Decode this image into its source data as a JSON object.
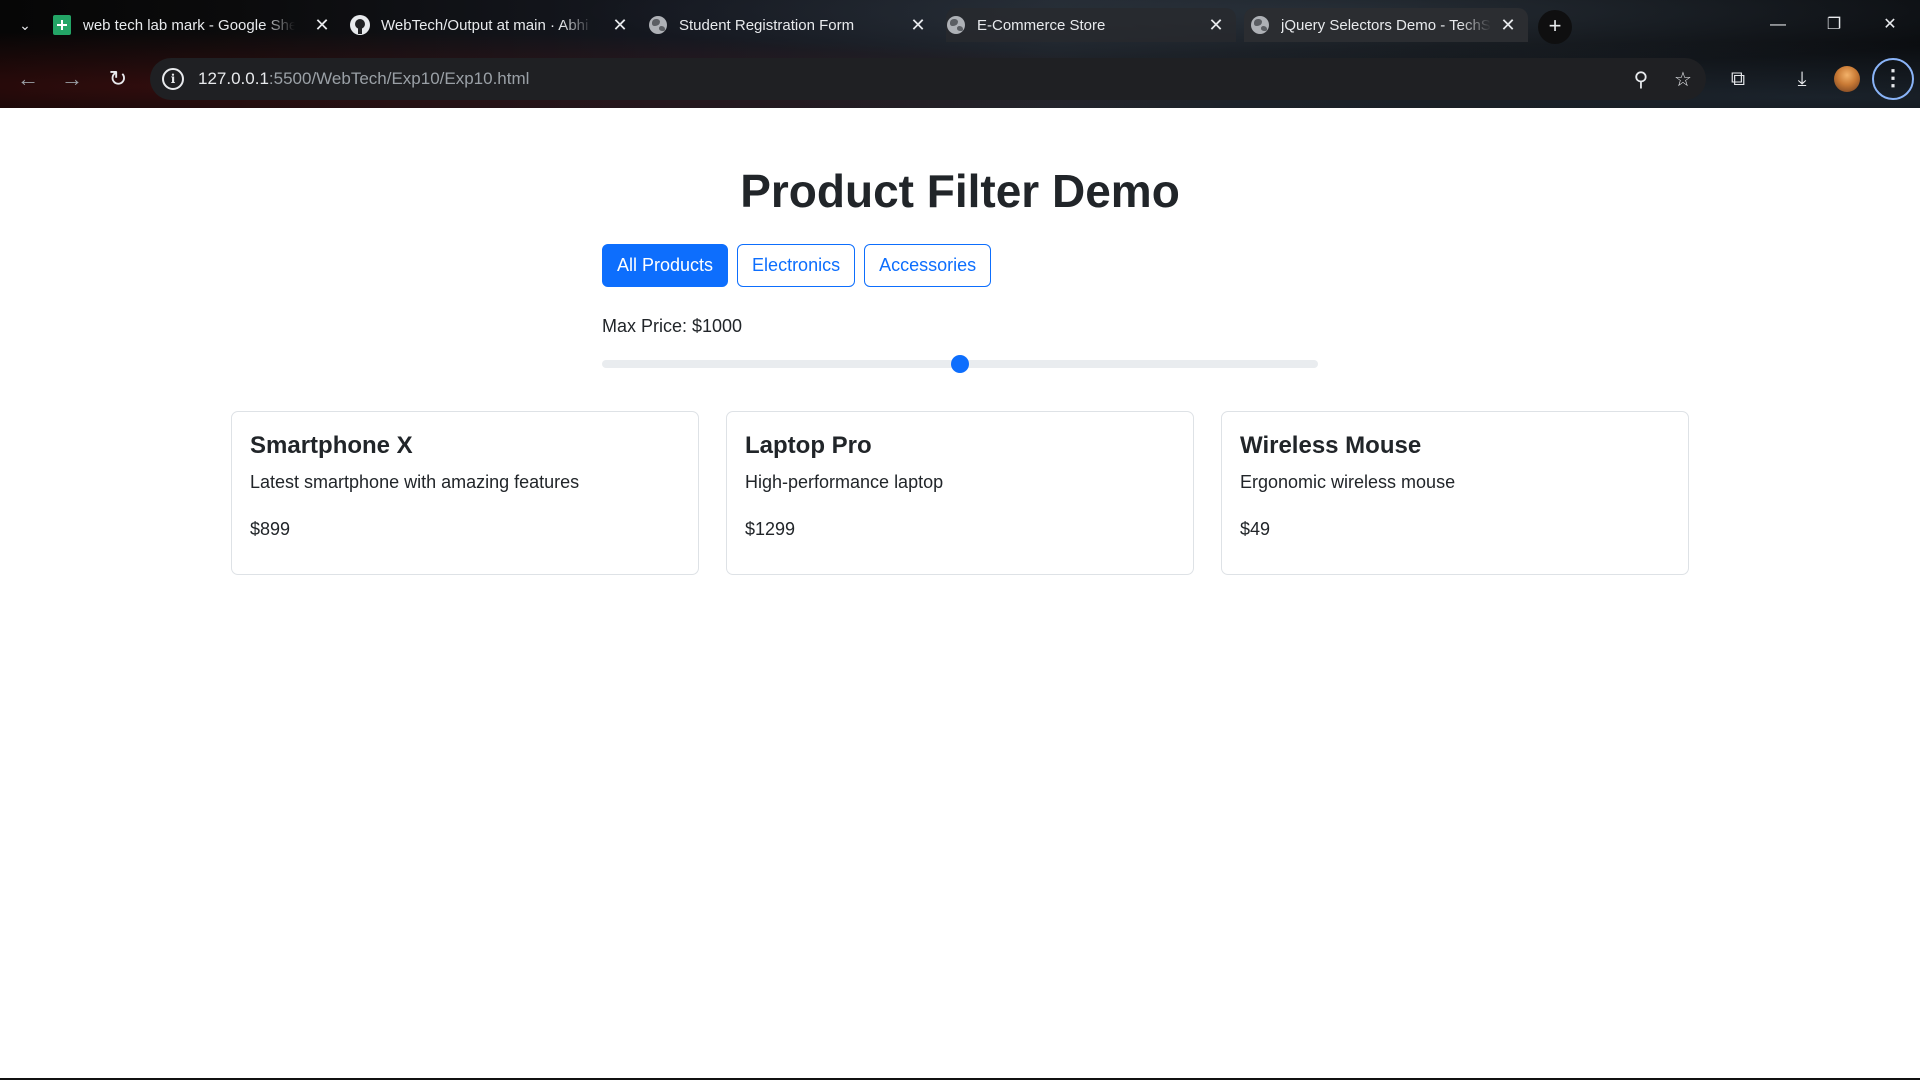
{
  "browser": {
    "tabs": [
      {
        "title": "web tech lab mark - Google Sheets",
        "favicon": "sheets-icon",
        "active": false
      },
      {
        "title": "WebTech/Output at main · Abhi",
        "favicon": "github-icon",
        "active": false
      },
      {
        "title": "Student Registration Form",
        "favicon": "globe-icon",
        "active": false
      },
      {
        "title": "E-Commerce Store",
        "favicon": "globe-icon",
        "active": false
      },
      {
        "title": "jQuery Selectors Demo - TechSt",
        "favicon": "globe-icon",
        "active": true
      }
    ],
    "url_host": "127.0.0.1",
    "url_path": ":5500/WebTech/Exp10/Exp10.html"
  },
  "page": {
    "title": "Product Filter Demo",
    "filters": [
      {
        "label": "All Products",
        "active": true
      },
      {
        "label": "Electronics",
        "active": false
      },
      {
        "label": "Accessories",
        "active": false
      }
    ],
    "price_label": "Max Price: $1000",
    "slider_fraction": 0.5,
    "products": [
      {
        "name": "Smartphone X",
        "description": "Latest smartphone with amazing features",
        "price": "$899"
      },
      {
        "name": "Laptop Pro",
        "description": "High-performance laptop",
        "price": "$1299"
      },
      {
        "name": "Wireless Mouse",
        "description": "Ergonomic wireless mouse",
        "price": "$49"
      }
    ]
  },
  "colors": {
    "primary": "#0d6efd",
    "text": "#212529",
    "border": "#dee2e6"
  }
}
